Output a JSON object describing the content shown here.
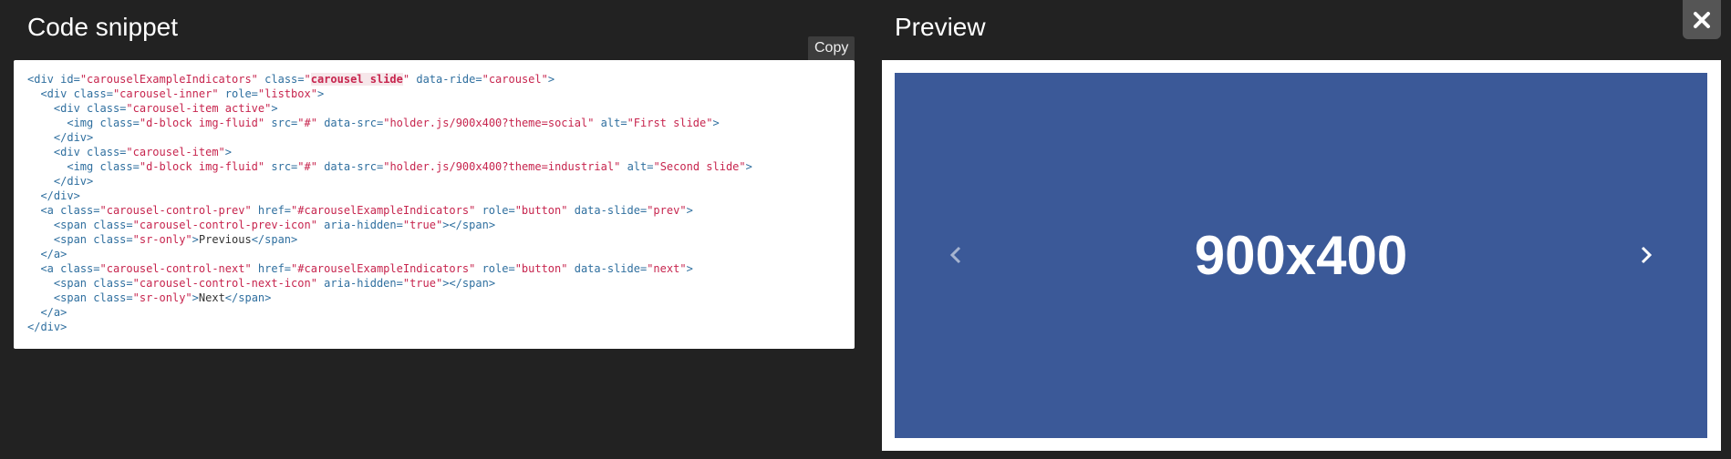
{
  "code_panel": {
    "title": "Code snippet",
    "copy_label": "Copy"
  },
  "preview_panel": {
    "title": "Preview",
    "slide_text": "900x400",
    "slide_color": "#3b5998"
  },
  "close": {
    "icon": "close-icon"
  },
  "code_lines": [
    "<div id=\"carouselExampleIndicators\" class=\"carousel slide\" data-ride=\"carousel\">",
    "  <div class=\"carousel-inner\" role=\"listbox\">",
    "    <div class=\"carousel-item active\">",
    "      <img class=\"d-block img-fluid\" src=\"#\" data-src=\"holder.js/900x400?theme=social\" alt=\"First slide\">",
    "    </div>",
    "    <div class=\"carousel-item\">",
    "      <img class=\"d-block img-fluid\" src=\"#\" data-src=\"holder.js/900x400?theme=industrial\" alt=\"Second slide\">",
    "    </div>",
    "  </div>",
    "  <a class=\"carousel-control-prev\" href=\"#carouselExampleIndicators\" role=\"button\" data-slide=\"prev\">",
    "    <span class=\"carousel-control-prev-icon\" aria-hidden=\"true\"></span>",
    "    <span class=\"sr-only\">Previous</span>",
    "  </a>",
    "  <a class=\"carousel-control-next\" href=\"#carouselExampleIndicators\" role=\"button\" data-slide=\"next\">",
    "    <span class=\"carousel-control-next-icon\" aria-hidden=\"true\"></span>",
    "    <span class=\"sr-only\">Next</span>",
    "  </a>",
    "</div>"
  ],
  "highlight": "carousel slide"
}
